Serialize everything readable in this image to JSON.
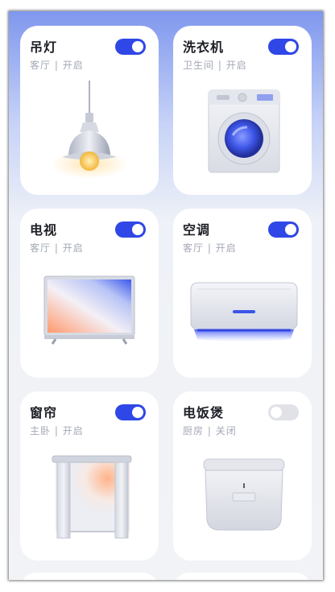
{
  "devices": [
    {
      "name": "吊灯",
      "location": "客厅",
      "status": "开启",
      "on": true,
      "icon": "pendant-lamp-icon"
    },
    {
      "name": "洗衣机",
      "location": "卫生间",
      "status": "开启",
      "on": true,
      "icon": "washing-machine-icon"
    },
    {
      "name": "电视",
      "location": "客厅",
      "status": "开启",
      "on": true,
      "icon": "tv-icon"
    },
    {
      "name": "空调",
      "location": "客厅",
      "status": "开启",
      "on": true,
      "icon": "air-conditioner-icon"
    },
    {
      "name": "窗帘",
      "location": "主卧",
      "status": "开启",
      "on": true,
      "icon": "curtain-icon"
    },
    {
      "name": "电饭煲",
      "location": "厨房",
      "status": "关闭",
      "on": false,
      "icon": "rice-cooker-icon"
    }
  ],
  "colors": {
    "accent": "#2f47e6",
    "toggle_off": "#e0e2e8",
    "title": "#1d1f26",
    "subtitle": "#a3a8b5"
  }
}
